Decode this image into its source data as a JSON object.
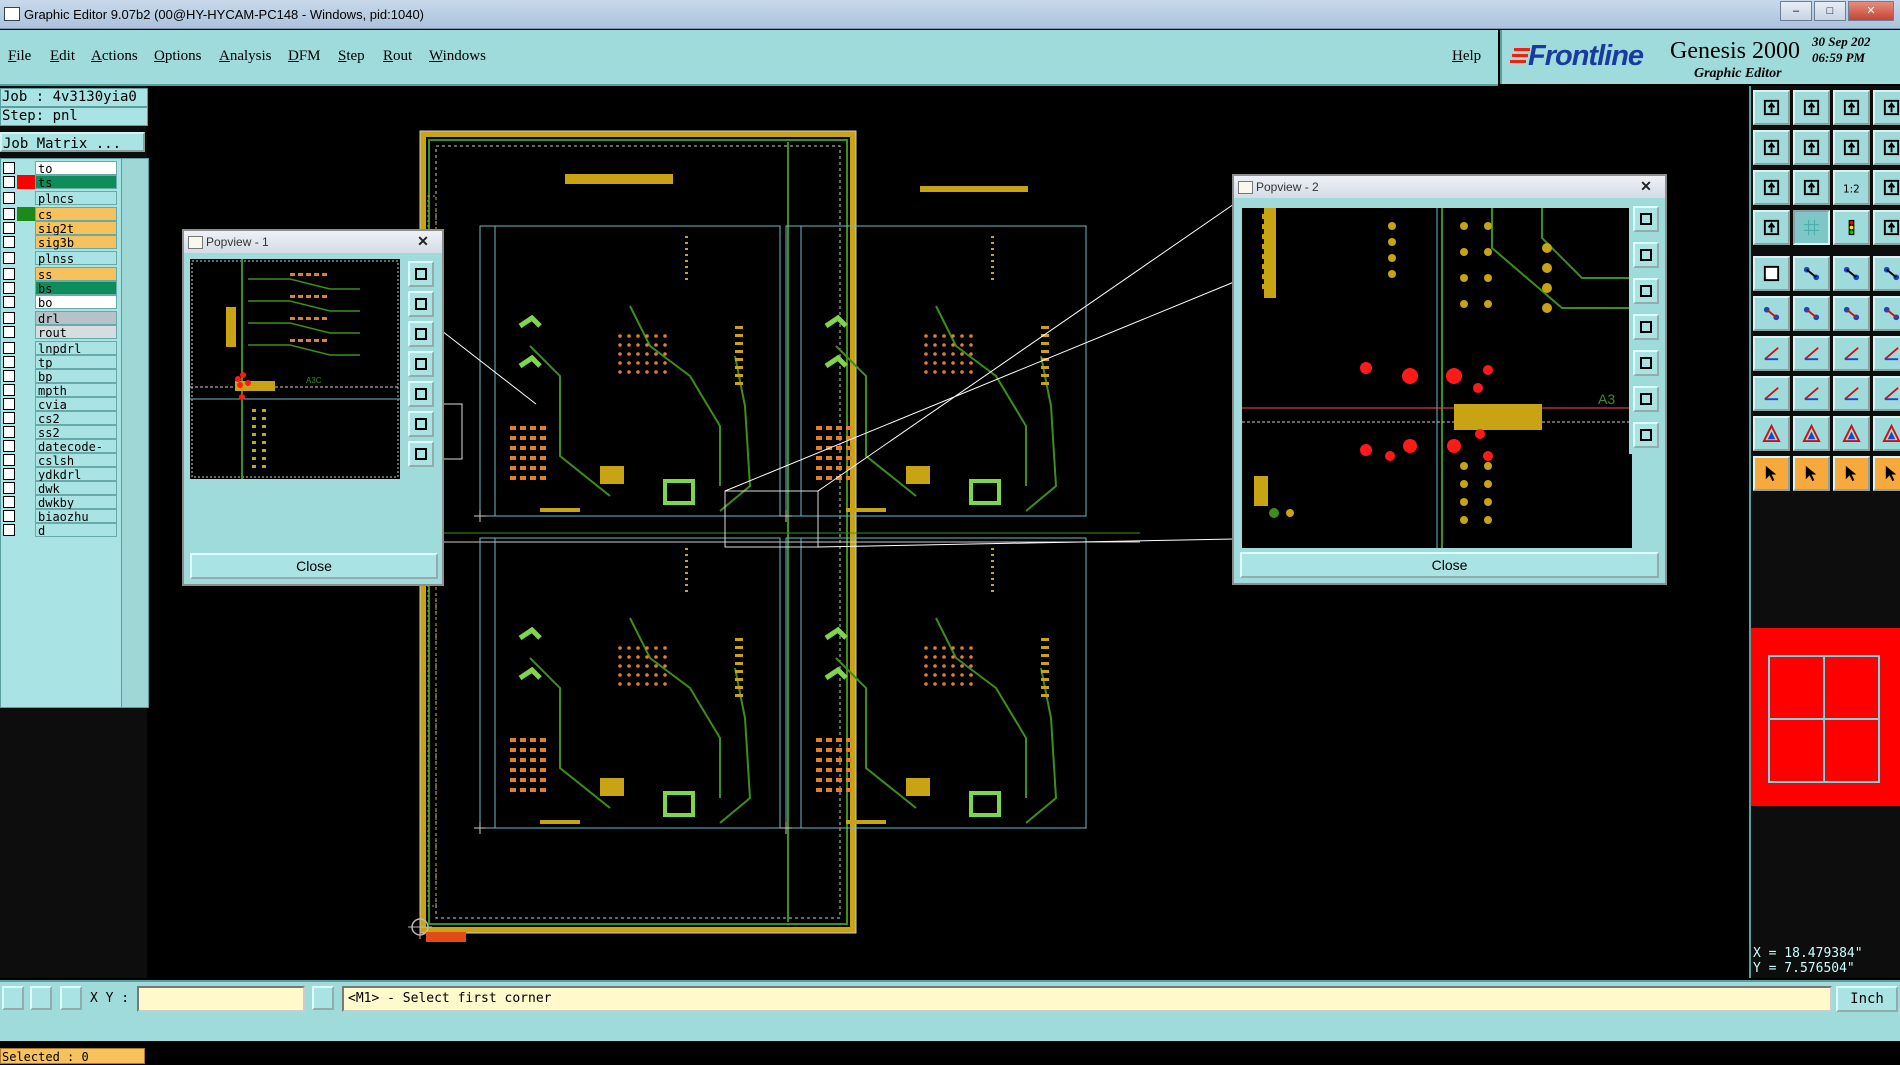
{
  "window": {
    "title": "Graphic Editor 9.07b2 (00@HY-HYCAM-PC148 - Windows, pid:1040)",
    "controls": [
      "–",
      "□",
      "✕"
    ]
  },
  "menu": [
    "File",
    "Edit",
    "Actions",
    "Options",
    "Analysis",
    "DFM",
    "Step",
    "Rout",
    "Windows"
  ],
  "help_label": "Help",
  "logo": {
    "brand": "Frontline",
    "product": "Genesis 2000",
    "subtitle": "Graphic Editor",
    "date": "30 Sep 202",
    "time": "06:59 PM"
  },
  "job": {
    "job_line": "Job : 4v3130yia0",
    "step_line": "Step: pnl",
    "matrix_label": "Job Matrix ..."
  },
  "layers": [
    {
      "name": "to",
      "fill": "#ffffff",
      "indicator": ""
    },
    {
      "name": "ts",
      "fill": "#0e8c5a",
      "indicator": "#ff0000"
    },
    {
      "name": "plncs",
      "fill": "#a9e3e3",
      "indicator": ""
    },
    {
      "name": "cs",
      "fill": "#f7c25b",
      "indicator": "#1b8a1b"
    },
    {
      "name": "sig2t",
      "fill": "#f7c25b",
      "indicator": ""
    },
    {
      "name": "sig3b",
      "fill": "#f7c25b",
      "indicator": ""
    },
    {
      "name": "plnss",
      "fill": "#a9e3e3",
      "indicator": ""
    },
    {
      "name": "ss",
      "fill": "#f7c25b",
      "indicator": ""
    },
    {
      "name": "bs",
      "fill": "#0e8c5a",
      "indicator": ""
    },
    {
      "name": "bo",
      "fill": "#ffffff",
      "indicator": ""
    },
    {
      "name": "drl",
      "fill": "#b7c2c8",
      "indicator": ""
    },
    {
      "name": "rout",
      "fill": "#d6dde0",
      "indicator": ""
    },
    {
      "name": "lnpdrl",
      "fill": "#a9e3e3",
      "indicator": ""
    },
    {
      "name": "tp",
      "fill": "#a9e3e3",
      "indicator": ""
    },
    {
      "name": "bp",
      "fill": "#a9e3e3",
      "indicator": ""
    },
    {
      "name": "mpth",
      "fill": "#a9e3e3",
      "indicator": ""
    },
    {
      "name": "cvia",
      "fill": "#a9e3e3",
      "indicator": ""
    },
    {
      "name": "cs2",
      "fill": "#a9e3e3",
      "indicator": ""
    },
    {
      "name": "ss2",
      "fill": "#a9e3e3",
      "indicator": ""
    },
    {
      "name": "datecode-ptc",
      "fill": "#a9e3e3",
      "indicator": ""
    },
    {
      "name": "cslsh",
      "fill": "#a9e3e3",
      "indicator": ""
    },
    {
      "name": "ydkdrl",
      "fill": "#a9e3e3",
      "indicator": ""
    },
    {
      "name": "dwk",
      "fill": "#a9e3e3",
      "indicator": ""
    },
    {
      "name": "dwkby",
      "fill": "#a9e3e3",
      "indicator": ""
    },
    {
      "name": "biaozhu",
      "fill": "#a9e3e3",
      "indicator": ""
    },
    {
      "name": "d",
      "fill": "#a9e3e3",
      "indicator": ""
    }
  ],
  "selected_label": "Selected : 0",
  "popview1": {
    "title": "Popview - 1",
    "close_label": "Close",
    "label_a": "A3C"
  },
  "popview2": {
    "title": "Popview - 2",
    "close_label": "Close",
    "label_a": "A3"
  },
  "coords": {
    "x": "X = 18.479384\"",
    "y": "Y = 7.576504\""
  },
  "bottom": {
    "xy_label": "X Y :",
    "xy_value": "",
    "message": "<M1> - Select first corner",
    "unit": "Inch"
  },
  "colors": {
    "panel": "#9fdbdb",
    "copper": "#c8a415",
    "trace": "#3d8f1a",
    "outline": "#6fb7c7",
    "pad_red": "#ff1a1a"
  }
}
